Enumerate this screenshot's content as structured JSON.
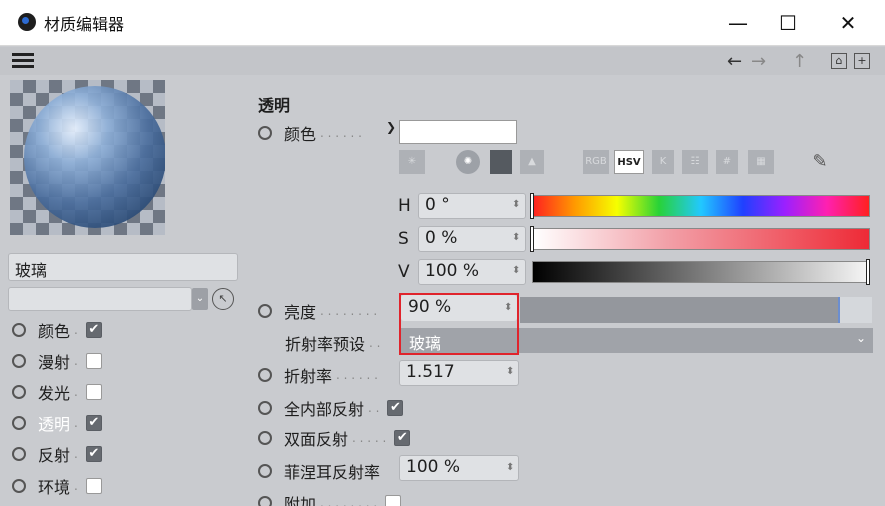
{
  "window": {
    "title": "材质编辑器",
    "minimize": "—",
    "maximize": "☐",
    "close": "✕"
  },
  "toolbar": {
    "back_icon": "←",
    "forward_icon": "→",
    "up_icon": "↑",
    "lock_icon": "🔓",
    "new_icon": "⊞"
  },
  "left": {
    "material_name": "玻璃",
    "channels": [
      {
        "label": "颜色",
        "checked": true
      },
      {
        "label": "漫射",
        "checked": false
      },
      {
        "label": "发光",
        "checked": false
      },
      {
        "label": "透明",
        "checked": true,
        "selected": true
      },
      {
        "label": "反射",
        "checked": true
      },
      {
        "label": "环境",
        "checked": false
      }
    ]
  },
  "panel": {
    "section_title": "透明",
    "color_label": "颜色",
    "tools": [
      "RGB",
      "HSV",
      "K",
      "#"
    ],
    "h_label": "H",
    "h_value": "0 °",
    "s_label": "S",
    "s_value": "0 %",
    "v_label": "V",
    "v_value": "100 %",
    "brightness_label": "亮度",
    "brightness_value": "90 %",
    "brightness_fraction": 0.9,
    "ior_preset_label": "折射率预设",
    "ior_preset_value": "玻璃",
    "ior_label": "折射率",
    "ior_value": "1.517",
    "total_internal_label": "全内部反射",
    "two_sided_label": "双面反射",
    "fresnel_label": "菲涅耳反射率",
    "fresnel_value": "100 %",
    "additive_label": "附加"
  },
  "colors": {
    "highlight": "#e0242c",
    "checked_box": "#666a70"
  }
}
